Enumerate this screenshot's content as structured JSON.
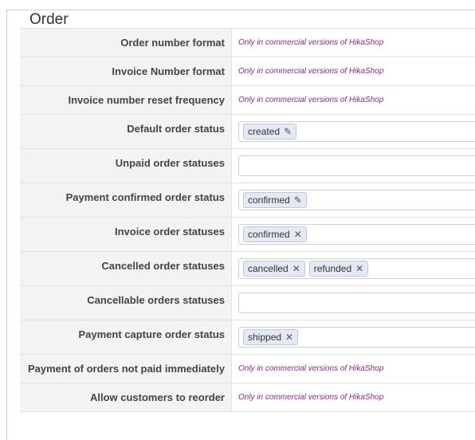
{
  "section": {
    "title": "Order"
  },
  "rows": [
    {
      "label": "Order number format",
      "note": "Only in commercial versions of HikaShop"
    },
    {
      "label": "Invoice Number format",
      "note": "Only in commercial versions of HikaShop"
    },
    {
      "label": "Invoice number reset frequency",
      "note": "Only in commercial versions of HikaShop"
    },
    {
      "label": "Default order status",
      "tags": [
        {
          "text": "created",
          "icon": "pencil-icon",
          "glyph": "✎"
        }
      ]
    },
    {
      "label": "Unpaid order statuses",
      "tags": []
    },
    {
      "label": "Payment confirmed order status",
      "tags": [
        {
          "text": "confirmed",
          "icon": "pencil-icon",
          "glyph": "✎"
        }
      ]
    },
    {
      "label": "Invoice order statuses",
      "tags": [
        {
          "text": "confirmed",
          "icon": "remove-icon",
          "glyph": "✕"
        }
      ]
    },
    {
      "label": "Cancelled order statuses",
      "tags": [
        {
          "text": "cancelled",
          "icon": "remove-icon",
          "glyph": "✕"
        },
        {
          "text": "refunded",
          "icon": "remove-icon",
          "glyph": "✕"
        }
      ]
    },
    {
      "label": "Cancellable orders statuses",
      "tags": []
    },
    {
      "label": "Payment capture order status",
      "tags": [
        {
          "text": "shipped",
          "icon": "remove-icon",
          "glyph": "✕"
        }
      ]
    },
    {
      "label": "Payment of orders not paid immediately",
      "note": "Only in commercial versions of HikaShop"
    },
    {
      "label": "Allow customers to reorder",
      "note": "Only in commercial versions of HikaShop"
    }
  ],
  "colors": {
    "note": "#8b2a8b",
    "tag_bg": "#e4e9f4",
    "label_bg": "#f3f3f3"
  }
}
